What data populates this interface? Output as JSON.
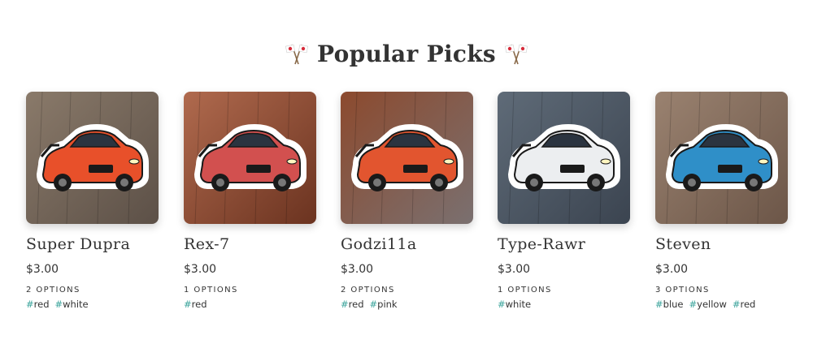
{
  "section": {
    "title": "Popular Picks",
    "left_icon": "crossed-flags-icon",
    "right_icon": "crossed-flags-icon"
  },
  "colors": {
    "text": "#333333",
    "tag_hash": "#3aa39b",
    "background": "#ffffff"
  },
  "products": [
    {
      "name": "Super Dupra",
      "price": "$3.00",
      "options": "2 OPTIONS",
      "tags": [
        {
          "hash": "#",
          "label": "red"
        },
        {
          "hash": "#",
          "label": "white"
        }
      ],
      "car_color": "#e8502a",
      "bg": [
        "#8a7a6a",
        "#5c5047"
      ]
    },
    {
      "name": "Rex-7",
      "price": "$3.00",
      "options": "1 OPTIONS",
      "tags": [
        {
          "hash": "#",
          "label": "red"
        }
      ],
      "car_color": "#d2504f",
      "bg": [
        "#b06a4e",
        "#6b3320"
      ]
    },
    {
      "name": "Godzi11a",
      "price": "$3.00",
      "options": "2 OPTIONS",
      "tags": [
        {
          "hash": "#",
          "label": "red"
        },
        {
          "hash": "#",
          "label": "pink"
        }
      ],
      "car_color": "#e2552f",
      "bg": [
        "#8c4a2e",
        "#7a7070"
      ]
    },
    {
      "name": "Type-Rawr",
      "price": "$3.00",
      "options": "1 OPTIONS",
      "tags": [
        {
          "hash": "#",
          "label": "white"
        }
      ],
      "car_color": "#eceef0",
      "bg": [
        "#5f6b78",
        "#3b4450"
      ]
    },
    {
      "name": "Steven",
      "price": "$3.00",
      "options": "3 OPTIONS",
      "tags": [
        {
          "hash": "#",
          "label": "blue"
        },
        {
          "hash": "#",
          "label": "yellow"
        },
        {
          "hash": "#",
          "label": "red"
        }
      ],
      "car_color": "#2f8fc8",
      "bg": [
        "#9a8270",
        "#6c5648"
      ]
    }
  ]
}
